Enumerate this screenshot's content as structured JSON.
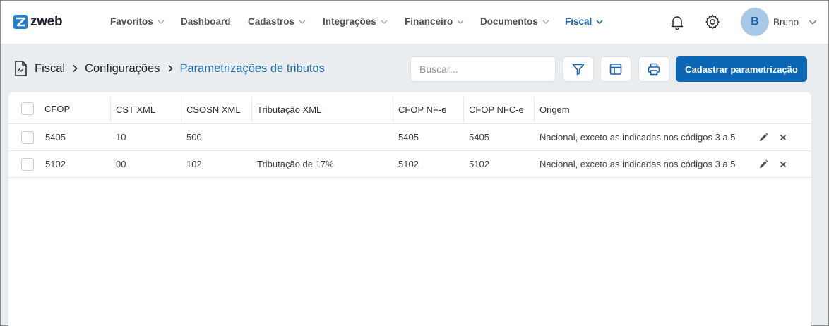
{
  "brand": {
    "name": "zweb"
  },
  "nav": [
    {
      "label": "Favoritos",
      "dropdown": true
    },
    {
      "label": "Dashboard",
      "dropdown": false
    },
    {
      "label": "Cadastros",
      "dropdown": true
    },
    {
      "label": "Integrações",
      "dropdown": true
    },
    {
      "label": "Financeiro",
      "dropdown": true
    },
    {
      "label": "Documentos",
      "dropdown": true
    },
    {
      "label": "Fiscal",
      "dropdown": true,
      "active": true
    }
  ],
  "user": {
    "initial": "B",
    "name": "Bruno"
  },
  "breadcrumb": [
    "Fiscal",
    "Configurações",
    "Parametrizações de tributos"
  ],
  "search": {
    "placeholder": "Buscar...",
    "value": ""
  },
  "toolbar": {
    "primary_label": "Cadastrar parametrização"
  },
  "table": {
    "columns": [
      "CFOP",
      "CST XML",
      "CSOSN XML",
      "Tributação XML",
      "CFOP NF-e",
      "CFOP NFC-e",
      "Origem"
    ],
    "rows": [
      [
        "5405",
        "10",
        "500",
        "",
        "5405",
        "5405",
        "Nacional, exceto as indicadas nos códigos 3 a 5"
      ],
      [
        "5102",
        "00",
        "102",
        "Tributação de 17%",
        "5102",
        "5102",
        "Nacional, exceto as indicadas nos códigos 3 a 5"
      ]
    ]
  },
  "icons": {
    "filter": "filter-icon",
    "layout": "columns-layout-icon",
    "print": "printer-icon",
    "bell": "bell-icon",
    "gear": "gear-icon",
    "edit": "pencil-icon",
    "delete": "close-icon",
    "page": "document-icon"
  },
  "colors": {
    "accent": "#0b67b5",
    "active_nav": "#1565a8",
    "avatar_bg": "#a9c8e6"
  }
}
